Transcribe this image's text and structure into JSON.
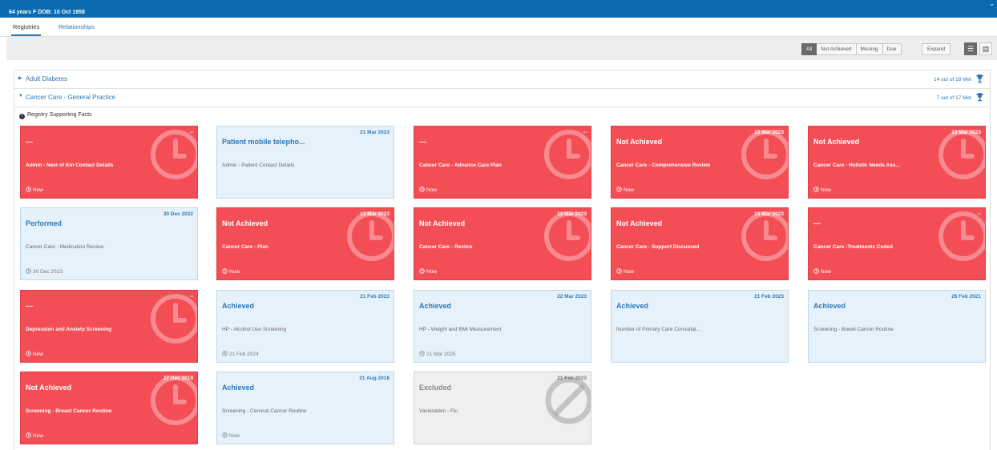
{
  "header": {
    "patient_summary": "64 years   F   DOB: 10 Oct 1958"
  },
  "tabs": [
    {
      "label": "Registries",
      "active": true
    },
    {
      "label": "Relationships",
      "active": false
    }
  ],
  "toolbar": {
    "filters": [
      {
        "label": "All",
        "active": true
      },
      {
        "label": "Not Achieved",
        "active": false
      },
      {
        "label": "Missing",
        "active": false
      },
      {
        "label": "Due",
        "active": false
      }
    ],
    "expand_label": "Expand",
    "view_toggle": [
      "list-view-icon",
      "compact-view-icon"
    ]
  },
  "registries": [
    {
      "name": "Adult Diabetes",
      "expanded": false,
      "count": "14 out of 18 Met"
    },
    {
      "name": "Cancer Care - General Practice",
      "expanded": true,
      "count": "7 out of 17 Met"
    }
  ],
  "supporting_facts_label": "Registry Supporting Facts",
  "cards": [
    {
      "style": "red",
      "status": "---",
      "label": "Admin - Next of Kin Contact Details",
      "date": "--",
      "footer": "Now",
      "icon": "clock-icon"
    },
    {
      "style": "blue",
      "status": "Patient mobile telepho...",
      "label": "Admin - Patient Contact Details",
      "date": "21 Mar 2023",
      "footer": "",
      "icon": ""
    },
    {
      "style": "red",
      "status": "---",
      "label": "Cancer Care - Advance Care Plan",
      "date": "--",
      "footer": "Now",
      "icon": "clock-icon"
    },
    {
      "style": "red",
      "status": "Not Achieved",
      "label": "Cancer Care - Comprehensive Review",
      "date": "13 Mar 2023",
      "footer": "Now",
      "icon": "clock-icon"
    },
    {
      "style": "red",
      "status": "Not Achieved",
      "label": "Cancer Care - Holistic Needs Ass...",
      "date": "13 Mar 2023",
      "footer": "Now",
      "icon": "clock-icon"
    },
    {
      "style": "blue",
      "status": "Performed",
      "label": "Cancer Care - Medication Review",
      "date": "30 Dec 2022",
      "footer": "30 Dec 2023",
      "icon": ""
    },
    {
      "style": "red",
      "status": "Not Achieved",
      "label": "Cancer Care - Plan",
      "date": "13 Mar 2023",
      "footer": "Now",
      "icon": "clock-icon"
    },
    {
      "style": "red",
      "status": "Not Achieved",
      "label": "Cancer Care - Review",
      "date": "13 Mar 2023",
      "footer": "Now",
      "icon": "clock-icon"
    },
    {
      "style": "red",
      "status": "Not Achieved",
      "label": "Cancer Care - Support Discussed",
      "date": "13 Mar 2023",
      "footer": "Now",
      "icon": "clock-icon"
    },
    {
      "style": "red",
      "status": "---",
      "label": "Cancer Care -Treatments Coded",
      "date": "--",
      "footer": "Now",
      "icon": "clock-icon"
    },
    {
      "style": "red",
      "status": "---",
      "label": "Depression and Anxiety Screening",
      "date": "--",
      "footer": "Now",
      "icon": "clock-icon"
    },
    {
      "style": "blue",
      "status": "Achieved",
      "label": "HP - Alcohol Use Screening",
      "date": "21 Feb 2023",
      "footer": "21 Feb 2024",
      "icon": ""
    },
    {
      "style": "blue",
      "status": "Achieved",
      "label": "HP - Weight and BMI Measurement",
      "date": "22 Mar 2023",
      "footer": "21 Mar 2025",
      "icon": ""
    },
    {
      "style": "blue",
      "status": "Achieved",
      "label": "Number of Primary Care Consultat...",
      "date": "21 Feb 2023",
      "footer": "",
      "icon": ""
    },
    {
      "style": "blue",
      "status": "Achieved",
      "label": "Screening - Bowel Cancer Routine",
      "date": "26 Feb 2021",
      "footer": "",
      "icon": ""
    },
    {
      "style": "red",
      "status": "Not Achieved",
      "label": "Screening - Breast Cancer Routine",
      "date": "27 Dec 2019",
      "footer": "Now",
      "icon": "clock-icon"
    },
    {
      "style": "blue",
      "status": "Achieved",
      "label": "Screening - Cervical Cancer Routine",
      "date": "21 Aug 2018",
      "footer": "Now",
      "icon": ""
    },
    {
      "style": "grey",
      "status": "Excluded",
      "label": "Vaccination - Flu",
      "date": "21 Feb 2023",
      "footer": "",
      "icon": "no-entry-icon"
    }
  ]
}
